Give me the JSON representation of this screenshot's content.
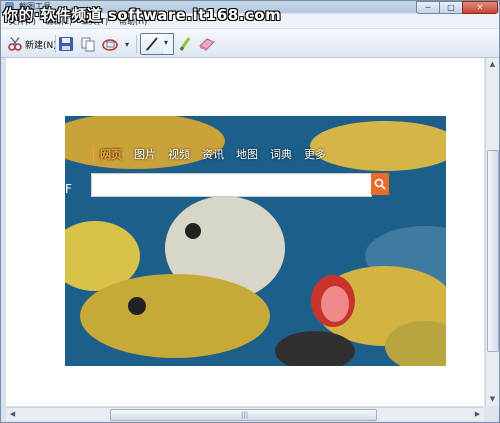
{
  "watermark": "你的·软件频道 software.it168.com",
  "window": {
    "title": "截图工具",
    "min": "─",
    "max": "□",
    "close": "✕"
  },
  "menu": {
    "file": "文件(F)",
    "edit": "编辑(E)",
    "tools": "工具(T)",
    "help": "帮助(H)"
  },
  "toolbar": {
    "new_label": "新建(N)"
  },
  "capture": {
    "nav": [
      "网页",
      "图片",
      "视频",
      "资讯",
      "地图",
      "词典",
      "更多"
    ],
    "logo_text": "F"
  },
  "colors": {
    "accent": "#f6a23a",
    "search_button": "#ea6b2a"
  },
  "icons": [
    "scissors-icon",
    "save-icon",
    "copy-icon",
    "send-icon",
    "pen-icon",
    "highlighter-icon",
    "eraser-icon",
    "search-icon"
  ]
}
